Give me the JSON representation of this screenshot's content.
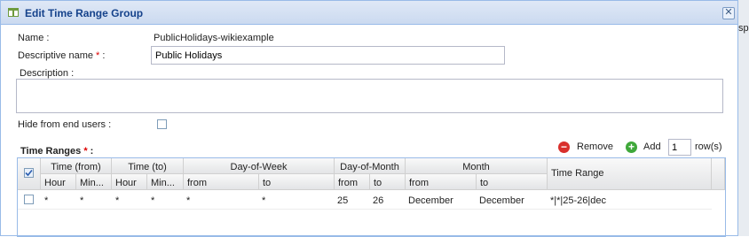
{
  "dialog": {
    "title": "Edit Time Range Group",
    "close_symbol": "✕"
  },
  "form": {
    "name_label": "Name :",
    "name_value": "PublicHolidays-wikiexample",
    "descriptive_name_label": "Descriptive name",
    "required_mark": "*",
    "colon": " :",
    "descriptive_name_value": "Public Holidays",
    "description_label": "Description :",
    "description_value": "",
    "hide_label": "Hide from end users :",
    "hide_checked": false
  },
  "time_ranges": {
    "label": "Time Ranges",
    "required_mark": "*",
    "colon": " :",
    "remove_label": "Remove",
    "add_label": "Add",
    "add_count": "1",
    "rows_suffix": "row(s)",
    "groups": {
      "time_from": "Time (from)",
      "time_to": "Time (to)",
      "day_of_week": "Day-of-Week",
      "day_of_month": "Day-of-Month",
      "month": "Month",
      "time_range": "Time Range"
    },
    "subheaders": {
      "hour_from": "Hour",
      "min_from": "Min...",
      "hour_to": "Hour",
      "min_to": "Min...",
      "dow_from": "from",
      "dow_to": "to",
      "dom_from": "from",
      "dom_to": "to",
      "month_from": "from",
      "month_to": "to"
    },
    "rows": [
      {
        "checked": false,
        "hour_from": "*",
        "min_from": "*",
        "hour_to": "*",
        "min_to": "*",
        "dow_from": "*",
        "dow_to": "*",
        "dom_from": "25",
        "dom_to": "26",
        "month_from": "December",
        "month_to": "December",
        "time_range": "*|*|25-26|dec"
      }
    ]
  },
  "background": {
    "right_edge_text": "sp"
  },
  "colors": {
    "title_text": "#15428b",
    "border": "#99bbe8",
    "required": "#dd0000",
    "remove_icon": "#d9302c",
    "add_icon": "#3fa83a"
  }
}
